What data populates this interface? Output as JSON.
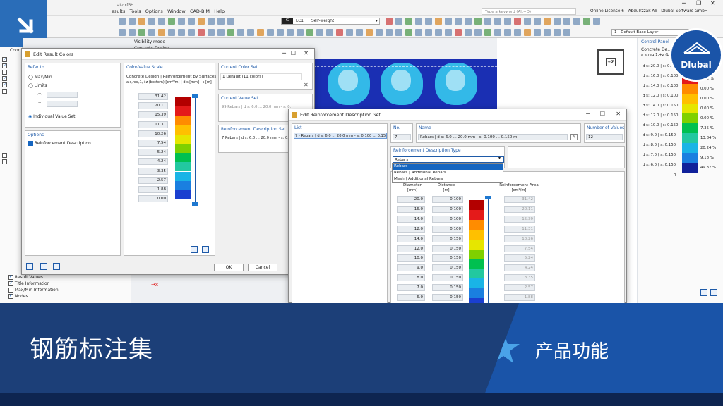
{
  "app": {
    "file_title": "...atz.rf6*",
    "menus": [
      "esults",
      "Tools",
      "Options",
      "Window",
      "CAD-BIM",
      "Help"
    ],
    "search_placeholder": "Type a keyword (Alt+Q)",
    "license_text": "Online License 6 | Abdulrzzak Ali | Dlubal Software GmbH",
    "load_case_id": "G",
    "load_case": "LC1",
    "load_case_name": "Self-weight",
    "layer": "1 - Default Base Layer",
    "visibility_mode": "Visibility mode",
    "concrete_design": "Concrete Design",
    "nav_label": "Conc",
    "navcube_label": "+Z",
    "flag_colors": [
      "#de2910",
      "#ffde00"
    ]
  },
  "brand": {
    "logo_text": "Dlubal",
    "logo_color": "#1a54a8"
  },
  "nav_tree": {
    "items": [
      "Result Values",
      "Title Information",
      "Max/Min Information",
      "Nodes"
    ]
  },
  "result_colors": {
    "title": "Edit Result Colors",
    "refer_to_title": "Refer to",
    "max_min": "Max/Min",
    "limits": "Limits",
    "limit_min": "[--]",
    "limit_max": "[--]",
    "individual": "Individual Value Set",
    "options_title": "Options",
    "reinf_desc": "Reinforcement Description",
    "scale_title": "Color-Value Scale",
    "scale_line1": "Concrete Design | Reinforcement by Surfaces",
    "scale_line2": "a s,req,1,+z (bottom) [cm²/m] | d s [mm] | s [m]",
    "values": [
      "31.42",
      "20.11",
      "15.39",
      "11.31",
      "10.26",
      "7.54",
      "5.24",
      "4.24",
      "3.35",
      "2.57",
      "1.88",
      "0.00"
    ],
    "current_color_title": "Current Color Set",
    "current_color_value": "1   Default (11 colors)",
    "current_value_title": "Current Value Set",
    "current_value_value": "99   Rebars | d s: 6.0 ... 20.0 mm - s: 0.",
    "reinf_set_title": "Reinforcement Description Set",
    "reinf_set_value": "7   Rebars | d s: 6.0 ... 20.0 mm - s: 0.",
    "ok": "OK",
    "cancel": "Cancel"
  },
  "reinf_dialog": {
    "title": "Edit Reinforcement Description Set",
    "list_title": "List",
    "list_item": "7 - Rebars | d s: 6.0 ... 20.0 mm - s: 0.100 ... 0.150 m",
    "no_title": "No.",
    "no_value": "7",
    "name_title": "Name",
    "name_value": "Rebars | d s: 6.0 ... 20.0 mm - s: 0.100 ... 0.150 m",
    "num_values_title": "Number of Values",
    "num_values": "12",
    "type_title": "Reinforcement Description Type",
    "type_selected": "Rebars",
    "type_options": [
      "Rebars",
      "Rebars | Additional Rebars",
      "Mesh | Additional Rebars"
    ],
    "col_diameter": "Diameter",
    "col_diameter_unit": "[mm]",
    "col_distance": "Distance",
    "col_distance_unit": "[m]",
    "col_area": "Reinforcement Area",
    "col_area_unit": "[cm²/m]",
    "rows": [
      {
        "d": "20.0",
        "s": "0.100",
        "a": "31.42"
      },
      {
        "d": "16.0",
        "s": "0.100",
        "a": "20.11"
      },
      {
        "d": "14.0",
        "s": "0.100",
        "a": "15.39"
      },
      {
        "d": "12.0",
        "s": "0.100",
        "a": "11.31"
      },
      {
        "d": "14.0",
        "s": "0.150",
        "a": "10.26"
      },
      {
        "d": "12.0",
        "s": "0.150",
        "a": "7.54"
      },
      {
        "d": "10.0",
        "s": "0.150",
        "a": "5.24"
      },
      {
        "d": "9.0",
        "s": "0.150",
        "a": "4.24"
      },
      {
        "d": "8.0",
        "s": "0.150",
        "a": "3.35"
      },
      {
        "d": "7.0",
        "s": "0.150",
        "a": "2.57"
      },
      {
        "d": "6.0",
        "s": "0.150",
        "a": "1.88"
      }
    ]
  },
  "control_panel": {
    "title": "Control Panel",
    "line1": "Concrete De...",
    "line2": "a s,req,1,+z (bo...",
    "rows": [
      {
        "label": "d s: 20.0 | s: 0.",
        "pct": ""
      },
      {
        "label": "d s: 16.0 | s: 0.100",
        "pct": "0.00 %"
      },
      {
        "label": "d s: 14.0 | s: 0.100",
        "pct": "0.00 %"
      },
      {
        "label": "d s: 12.0 | s: 0.100",
        "pct": "0.00 %"
      },
      {
        "label": "d s: 14.0 | s: 0.150",
        "pct": "0.00 %"
      },
      {
        "label": "d s: 12.0 | s: 0.150",
        "pct": "0.00 %"
      },
      {
        "label": "d s: 10.0 | s: 0.150",
        "pct": "7.35 %"
      },
      {
        "label": "d s: 9.0 | s: 0.150",
        "pct": "13.84 %"
      },
      {
        "label": "d s: 8.0 | s: 0.150",
        "pct": "20.24 %"
      },
      {
        "label": "d s: 7.0 | s: 0.150",
        "pct": "9.18 %"
      },
      {
        "label": "d s: 6.0 | s: 0.150",
        "pct": "49.37 %"
      }
    ],
    "zero": "0"
  },
  "scale_colors": [
    "#b30000",
    "#e41a1a",
    "#ff8c00",
    "#ffc000",
    "#e6e600",
    "#7fd000",
    "#00c050",
    "#22c8a0",
    "#19b4e6",
    "#1a7fe0",
    "#1a3fd0",
    "#10209a"
  ],
  "banner": {
    "title": "钢筋标注集",
    "subtitle": "产品功能"
  }
}
